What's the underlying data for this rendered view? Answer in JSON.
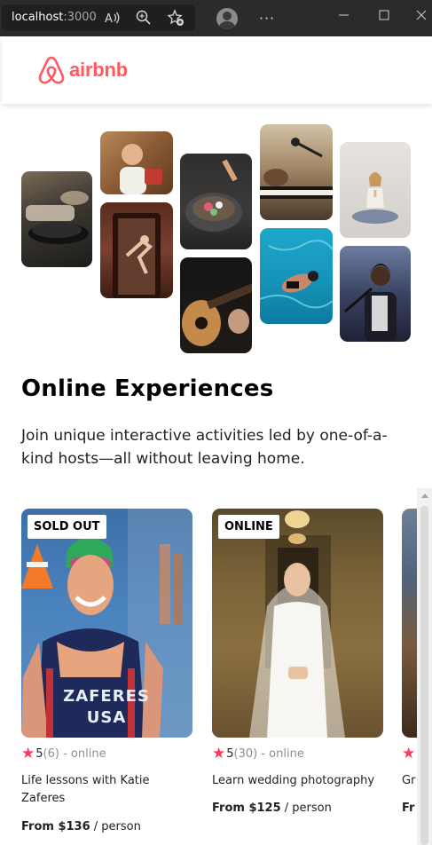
{
  "browser": {
    "url_host": "localhost",
    "url_port": ":3000",
    "icons": [
      "read-aloud-icon",
      "zoom-icon",
      "favorites-icon",
      "profile-avatar",
      "more-icon",
      "minimize-icon",
      "maximize-icon",
      "close-icon"
    ]
  },
  "navbar": {
    "logo_text": "airbnb",
    "brand_color": "#ff5a5f"
  },
  "hero": {
    "title": "Online Experiences",
    "subtitle": "Join unique interactive activities led by one-of-a-kind hosts—all without leaving home."
  },
  "cards": [
    {
      "badge": "SOLD OUT",
      "rating": "5",
      "reviews": "(6)",
      "location": " - online",
      "title": "Life lessons with Katie Zaferes",
      "price_prefix": "From ",
      "price": "$136",
      "price_suffix": " / person",
      "image_text": "ZAFERES USA"
    },
    {
      "badge": "ONLINE",
      "rating": "5",
      "reviews": "(30)",
      "location": " - online",
      "title": "Learn wedding photography",
      "price_prefix": "From ",
      "price": "$125",
      "price_suffix": " / person"
    },
    {
      "badge": "",
      "rating": "",
      "reviews": "",
      "location": "",
      "title": "Gr",
      "price_prefix": "Fr",
      "price": "",
      "price_suffix": ""
    }
  ],
  "colors": {
    "star": "#fe385d",
    "muted": "#918e8e"
  }
}
